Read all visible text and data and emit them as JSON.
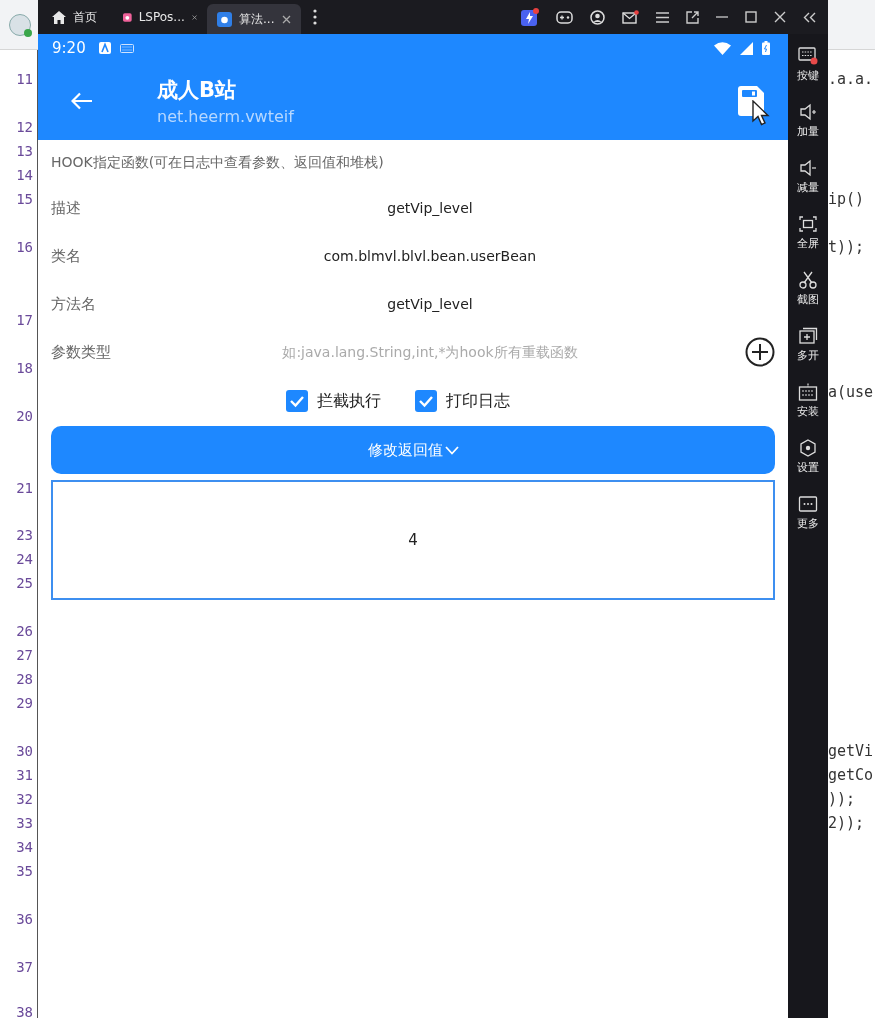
{
  "editor": {
    "line_numbers": [
      "11",
      "12",
      "13",
      "14",
      "15",
      "16",
      "17",
      "18",
      "20",
      "21",
      "23",
      "24",
      "25",
      "26",
      "27",
      "28",
      "29",
      "30",
      "31",
      "32",
      "33",
      "34",
      "35",
      "36",
      "37",
      "38"
    ],
    "code": [
      ".a.a.",
      "ip()",
      "t));",
      "a(use",
      "getVi",
      "getCo",
      "));",
      "2));"
    ]
  },
  "emulator": {
    "tabs": [
      {
        "label": "首页",
        "kind": "home",
        "selected": false
      },
      {
        "label": "LSPos...",
        "kind": "app",
        "color": "#f0629a",
        "selected": false
      },
      {
        "label": "算法...",
        "kind": "app",
        "color": "#2f7fe8",
        "selected": true
      }
    ],
    "status_bar": {
      "time": "9:20"
    },
    "app_bar": {
      "title": "成人B站",
      "subtitle": "net.heerm.vwteif"
    },
    "form": {
      "hint": "HOOK指定函数(可在日志中查看参数、返回值和堆栈)",
      "fields": [
        {
          "label": "描述",
          "value": "getVip_level",
          "kind": "value"
        },
        {
          "label": "类名",
          "value": "com.blmvl.blvl.bean.userBean",
          "kind": "value"
        },
        {
          "label": "方法名",
          "value": "getVip_level",
          "kind": "value"
        },
        {
          "label": "参数类型",
          "placeholder": "如:java.lang.String,int,*为hook所有重载函数",
          "kind": "input"
        }
      ],
      "checkboxes": [
        {
          "label": "拦截执行",
          "checked": true
        },
        {
          "label": "打印日志",
          "checked": true
        }
      ],
      "button": "修改返回值",
      "return_value": "4"
    },
    "sidebar": [
      {
        "label": "按键",
        "kind": "keys"
      },
      {
        "label": "加量",
        "kind": "vol-up"
      },
      {
        "label": "减量",
        "kind": "vol-down"
      },
      {
        "label": "全屏",
        "kind": "fullscreen"
      },
      {
        "label": "截图",
        "kind": "screenshot"
      },
      {
        "label": "多开",
        "kind": "multi"
      },
      {
        "label": "安装",
        "kind": "install"
      },
      {
        "label": "设置",
        "kind": "settings"
      },
      {
        "label": "更多",
        "kind": "more"
      }
    ]
  }
}
